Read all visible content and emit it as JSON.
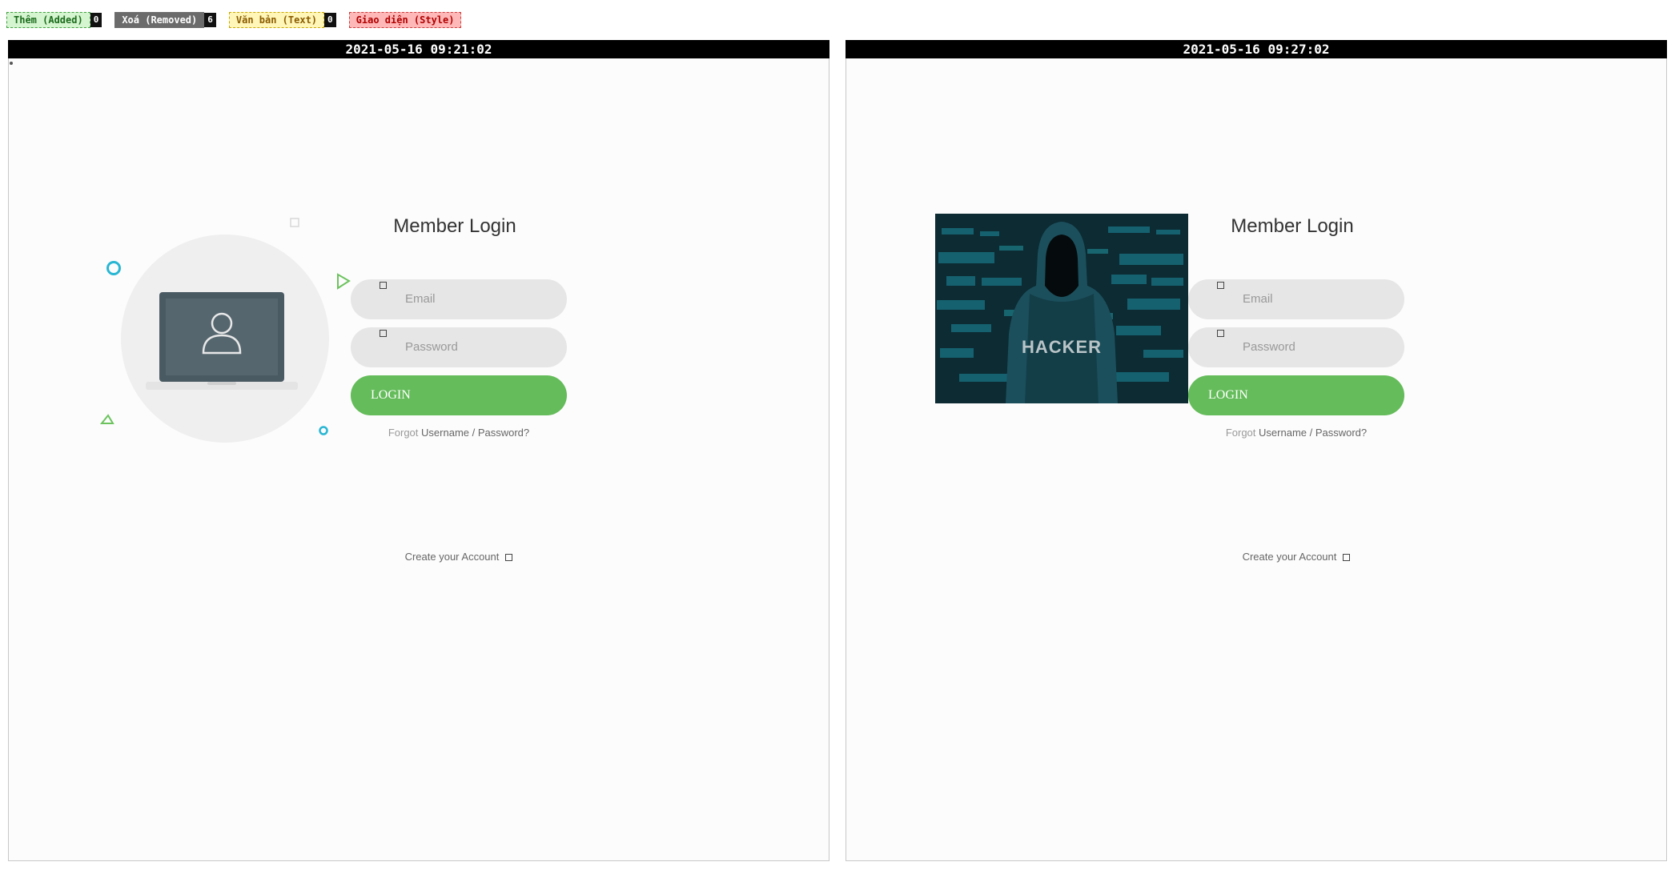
{
  "legend": {
    "added_label": "Thêm (Added)",
    "added_count": "0",
    "removed_label": "Xoá (Removed)",
    "removed_count": "6",
    "text_label": "Văn bản (Text)",
    "text_count": "0",
    "style_label": "Giao diện (Style)",
    "colors": {
      "added": "#d5f5d0",
      "removed": "#6b6b6b",
      "text": "#fff6b8",
      "style": "#ffb8b8"
    }
  },
  "left": {
    "timestamp": "2021-05-16 09:21:02",
    "illustration_icon": "laptop-user-icon"
  },
  "right": {
    "timestamp": "2021-05-16 09:27:02",
    "image_text": "HACKER"
  },
  "login": {
    "title": "Member Login",
    "email_placeholder": "Email",
    "password_placeholder": "Password",
    "login_label": "LOGIN",
    "forgot_prefix": "Forgot",
    "forgot_link": "Username / Password?",
    "create_account": "Create your Account",
    "accent": "#64bc5a"
  }
}
